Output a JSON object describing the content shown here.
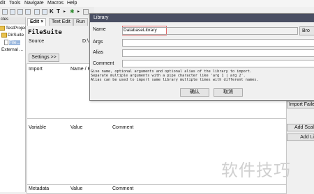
{
  "menubar": {
    "items": [
      "dit",
      "Tools",
      "Navigate",
      "Macros",
      "Help"
    ]
  },
  "tree": {
    "header": "ctes",
    "nodes": [
      "TestProject",
      "DirSuite",
      "File...",
      "External ..."
    ]
  },
  "main": {
    "tabs": [
      "Edit",
      "Text Edit",
      "Run"
    ],
    "tab_close": "×",
    "suite_title": "FileSuite",
    "source_label": "Source",
    "source_value": "D:\\",
    "settings_button": "Settings >>",
    "import_header": "Import",
    "name_header": "Name / P",
    "variable_header": "Variable",
    "value_header": "Value",
    "comment_header": "Comment",
    "metadata_header": "Metadata",
    "value_header2": "Value",
    "comment_header2": "Comment",
    "import_failed_button": "Import Faile",
    "add_scalar_button": "Add Scal",
    "add_list_button": "Add Li"
  },
  "dialog": {
    "title": "Library",
    "name_label": "Name",
    "name_value": "DatabaseLibrary",
    "browse_button": "Bro",
    "args_label": "Args",
    "alias_label": "Alias",
    "comment_label": "Comment",
    "help_lines": [
      "Give name, optional arguments and optional alias of the library to import.",
      "Separate multiple arguments with a pipe character like 'arg 1 | arg 2'.",
      "Alias can be used to import same library multiple times with different names."
    ],
    "ok_button": "确认",
    "cancel_button": "取消"
  },
  "watermark": "软件技巧"
}
